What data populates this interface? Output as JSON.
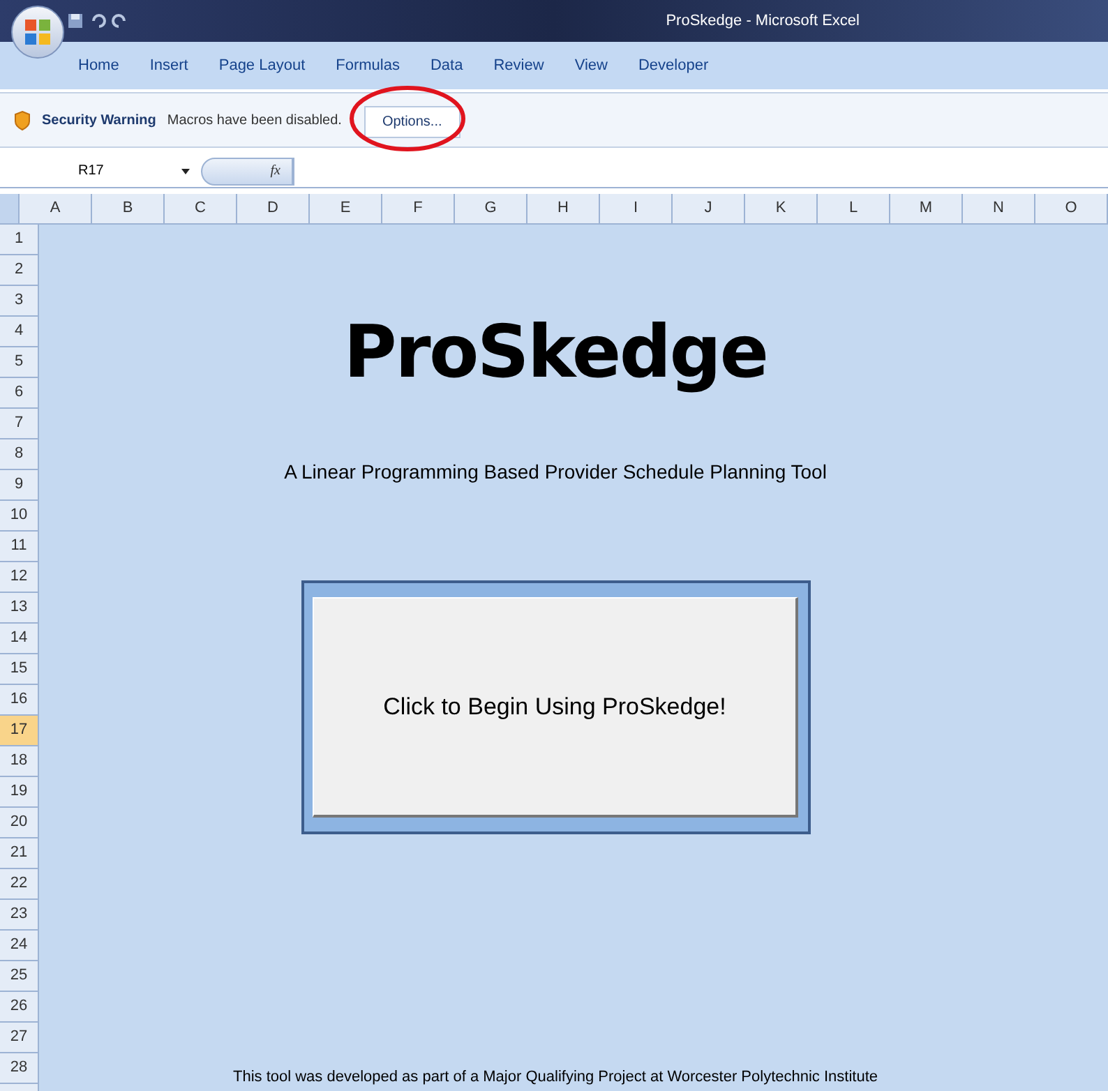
{
  "window": {
    "title": "ProSkedge - Microsoft Excel"
  },
  "ribbon_tabs": [
    "Home",
    "Insert",
    "Page Layout",
    "Formulas",
    "Data",
    "Review",
    "View",
    "Developer"
  ],
  "security_bar": {
    "title": "Security Warning",
    "message": "Macros have been disabled.",
    "button": "Options...",
    "highlighted": true
  },
  "formula_bar": {
    "name_box": "R17",
    "fx": "fx"
  },
  "columns": [
    "A",
    "B",
    "C",
    "D",
    "E",
    "F",
    "G",
    "H",
    "I",
    "J",
    "K",
    "L",
    "M",
    "N",
    "O"
  ],
  "rows": [
    {
      "label": "1",
      "selected": false
    },
    {
      "label": "2",
      "selected": false
    },
    {
      "label": "3",
      "selected": false
    },
    {
      "label": "4",
      "selected": false
    },
    {
      "label": "5",
      "selected": false
    },
    {
      "label": "6",
      "selected": false
    },
    {
      "label": "7",
      "selected": false
    },
    {
      "label": "8",
      "selected": false
    },
    {
      "label": "9",
      "selected": false
    },
    {
      "label": "10",
      "selected": false
    },
    {
      "label": "11",
      "selected": false
    },
    {
      "label": "12",
      "selected": false
    },
    {
      "label": "13",
      "selected": false
    },
    {
      "label": "14",
      "selected": false
    },
    {
      "label": "15",
      "selected": false
    },
    {
      "label": "16",
      "selected": false
    },
    {
      "label": "17",
      "selected": true
    },
    {
      "label": "18",
      "selected": false
    },
    {
      "label": "19",
      "selected": false
    },
    {
      "label": "20",
      "selected": false
    },
    {
      "label": "21",
      "selected": false
    },
    {
      "label": "22",
      "selected": false
    },
    {
      "label": "23",
      "selected": false
    },
    {
      "label": "24",
      "selected": false
    },
    {
      "label": "25",
      "selected": false
    },
    {
      "label": "26",
      "selected": false
    },
    {
      "label": "27",
      "selected": false
    },
    {
      "label": "28",
      "selected": false
    }
  ],
  "sheet": {
    "title": "ProSkedge",
    "subtitle": "A Linear Programming Based Provider Schedule Planning Tool",
    "start_button": "Click to Begin Using ProSkedge!",
    "footer": "This tool was developed as part of a Major Qualifying Project at Worcester Polytechnic Institute"
  }
}
